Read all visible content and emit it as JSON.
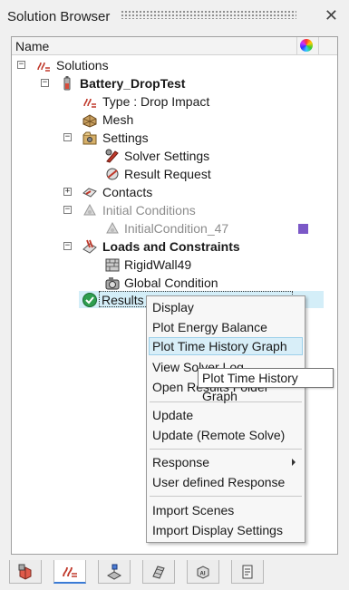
{
  "panel_title": "Solution Browser",
  "column_header": "Name",
  "tree": {
    "solutions": "Solutions",
    "battery": "Battery_DropTest",
    "type": "Type : Drop Impact",
    "mesh": "Mesh",
    "settings": "Settings",
    "solver_settings": "Solver Settings",
    "result_request": "Result Request",
    "contacts": "Contacts",
    "initial_conditions": "Initial Conditions",
    "initial_condition_47": "InitialCondition_47",
    "loads": "Loads and Constraints",
    "rigidwall": "RigidWall49",
    "global_condition": "Global Condition",
    "results": "Results"
  },
  "expanders": {
    "minus": "−",
    "plus": "+"
  },
  "colors": {
    "initial_condition_swatch": "#7b58c7",
    "selection": "#d4eef8",
    "highlight_border": "#9cd0ea"
  },
  "context_menu": {
    "display": "Display",
    "plot_energy": "Plot Energy Balance",
    "plot_time_history": "Plot Time History Graph",
    "view_solver_log": "View Solver Log",
    "open_results_folder": "Open Results Folder",
    "update": "Update",
    "update_remote": "Update (Remote Solve)",
    "response": "Response",
    "user_defined_response": "User defined Response",
    "import_scenes": "Import Scenes",
    "import_display_settings": "Import Display Settings"
  },
  "tooltip": "Plot Time History Graph",
  "bottom_tabs": [
    "model-icon",
    "solution-icon",
    "analysis-icon",
    "material-icon",
    "ai-icon",
    "report-icon"
  ]
}
